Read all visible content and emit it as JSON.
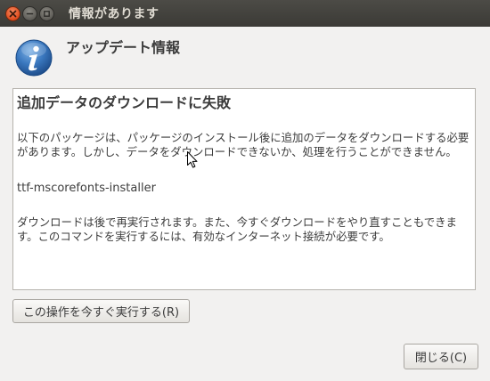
{
  "window": {
    "title": "情報があります"
  },
  "titlebar_buttons": {
    "close_icon": "close-icon",
    "minimize_icon": "minimize-icon",
    "maximize_icon": "maximize-icon"
  },
  "dialog": {
    "icon": "info-icon",
    "header": "アップデート情報",
    "details": {
      "heading": "追加データのダウンロードに失敗",
      "paragraph1": "以下のパッケージは、パッケージのインストール後に追加のデータをダウンロードする必要があります。しかし、データをダウンロードできないか、処理を行うことができません。",
      "package": "ttf-mscorefonts-installer",
      "paragraph2": "ダウンロードは後で再実行されます。また、今すぐダウンロードをやり直すこともできます。このコマンドを実行するには、有効なインターネット接続が必要です。"
    },
    "run_now_button": "この操作を今すぐ実行する(R)",
    "close_button": "閉じる(C)"
  },
  "colors": {
    "titlebar": "#3c3b37",
    "window_bg": "#f2f1f0",
    "close_orange": "#df4a1c",
    "info_blue": "#2f6bb0"
  }
}
